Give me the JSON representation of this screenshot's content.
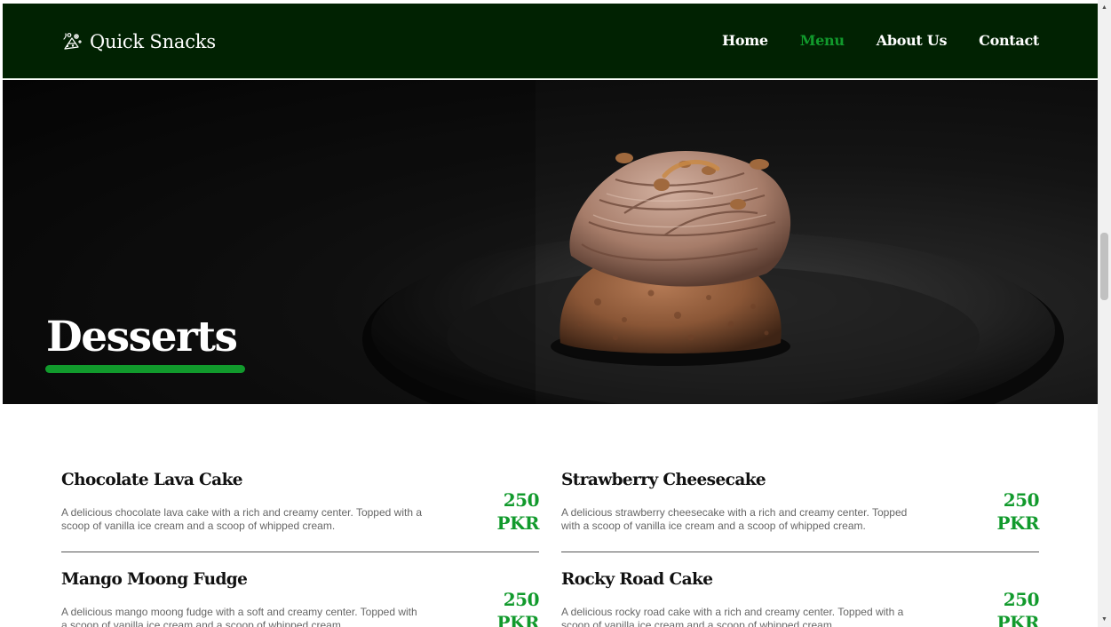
{
  "brand": {
    "name": "Quick Snacks",
    "icon": "snack-logo-icon"
  },
  "nav": {
    "items": [
      {
        "label": "Home",
        "active": false
      },
      {
        "label": "Menu",
        "active": true
      },
      {
        "label": "About Us",
        "active": false
      },
      {
        "label": "Contact",
        "active": false
      }
    ]
  },
  "hero": {
    "title": "Desserts",
    "image": "cupcake-on-plate-image"
  },
  "menu": {
    "items": [
      {
        "name": "Chocolate Lava Cake",
        "description": "A delicious chocolate lava cake with a rich and creamy center. Topped with a scoop of vanilla ice cream and a scoop of whipped cream.",
        "price": "250",
        "currency": "PKR"
      },
      {
        "name": "Strawberry Cheesecake",
        "description": "A delicious strawberry cheesecake with a rich and creamy center. Topped with a scoop of vanilla ice cream and a scoop of whipped cream.",
        "price": "250",
        "currency": "PKR"
      },
      {
        "name": "Mango Moong Fudge",
        "description": "A delicious mango moong fudge with a soft and creamy center. Topped with a scoop of vanilla ice cream and a scoop of whipped cream.",
        "price": "250",
        "currency": "PKR"
      },
      {
        "name": "Rocky Road Cake",
        "description": "A delicious rocky road cake with a rich and creamy center. Topped with a scoop of vanilla ice cream and a scoop of whipped cream.",
        "price": "250",
        "currency": "PKR"
      }
    ]
  },
  "colors": {
    "nav_bg": "#012202",
    "accent": "#119a2c",
    "text": "#111111",
    "muted": "#666666"
  }
}
